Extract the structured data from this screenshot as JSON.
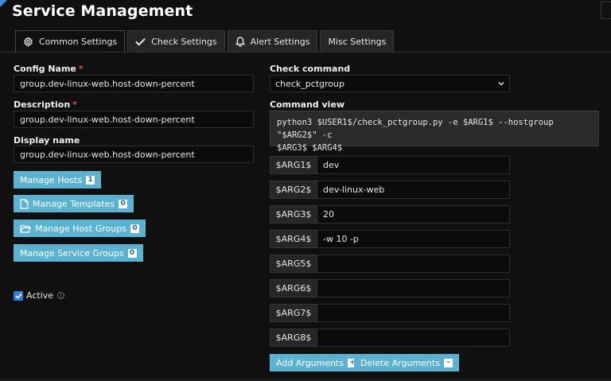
{
  "page": {
    "title": "Service Management"
  },
  "tabs": [
    {
      "label": "Common Settings",
      "icon": "gear-icon",
      "active": true
    },
    {
      "label": "Check Settings",
      "icon": "check-icon"
    },
    {
      "label": "Alert Settings",
      "icon": "bell-icon"
    },
    {
      "label": "Misc Settings",
      "icon": ""
    }
  ],
  "form": {
    "config_name": {
      "label": "Config Name",
      "required": "*",
      "value": "group.dev-linux-web.host-down-percent"
    },
    "description": {
      "label": "Description",
      "required": "*",
      "value": "group.dev-linux-web.host-down-percent"
    },
    "display_name": {
      "label": "Display name",
      "value": "group.dev-linux-web.host-down-percent"
    }
  },
  "buttons": {
    "manage_hosts": {
      "label": "Manage Hosts",
      "count": "1"
    },
    "manage_templates": {
      "label": "Manage Templates",
      "count": "0"
    },
    "manage_host_groups": {
      "label": "Manage Host Groups",
      "count": "0"
    },
    "manage_service_groups": {
      "label": "Manage Service Groups",
      "count": "0"
    },
    "add_arguments": {
      "label": "Add Arguments",
      "symbol": "+"
    },
    "delete_arguments": {
      "label": "Delete Arguments",
      "symbol": "-"
    }
  },
  "active": {
    "label": "Active",
    "checked": true,
    "info": "i"
  },
  "check_command": {
    "label": "Check command",
    "value": "check_pctgroup"
  },
  "command_view": {
    "label": "Command view",
    "line1": "python3 $USER1$/check_pctgroup.py -e $ARG1$ --hostgroup \"$ARG2$\" -c",
    "line2": "$ARG3$ $ARG4$"
  },
  "arguments": [
    {
      "name": "$ARG1$",
      "value": "dev"
    },
    {
      "name": "$ARG2$",
      "value": "dev-linux-web"
    },
    {
      "name": "$ARG3$",
      "value": "20"
    },
    {
      "name": "$ARG4$",
      "value": "-w 10 -p"
    },
    {
      "name": "$ARG5$",
      "value": ""
    },
    {
      "name": "$ARG6$",
      "value": ""
    },
    {
      "name": "$ARG7$",
      "value": ""
    },
    {
      "name": "$ARG8$",
      "value": ""
    }
  ],
  "colors": {
    "accent": "#5bb3d1",
    "checkbox": "#2f7de1",
    "required": "#e84848"
  }
}
